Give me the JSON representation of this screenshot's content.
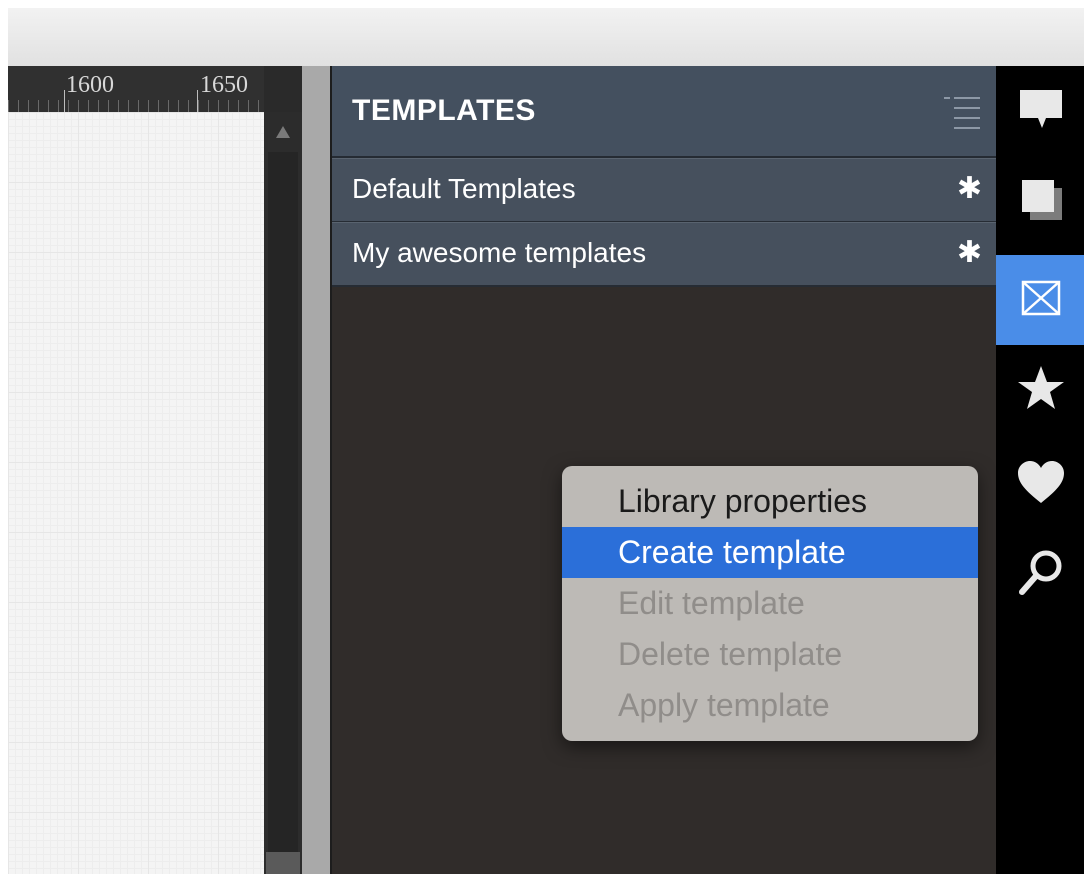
{
  "ruler": {
    "label_1600": "1600",
    "label_1650": "1650"
  },
  "templates_panel": {
    "title": "TEMPLATES",
    "menu_icon": "list-menu-icon",
    "libraries": [
      {
        "label": "Default Templates",
        "icon": "gear-icon"
      },
      {
        "label": "My awesome templates",
        "icon": "gear-icon"
      }
    ],
    "gear_glyph": "✱"
  },
  "context_menu": {
    "items": [
      {
        "label": "Library properties",
        "state": "enabled"
      },
      {
        "label": "Create template",
        "state": "selected"
      },
      {
        "label": "Edit template",
        "state": "disabled"
      },
      {
        "label": "Delete template",
        "state": "disabled"
      },
      {
        "label": "Apply template",
        "state": "disabled"
      }
    ]
  },
  "rail": {
    "items": [
      {
        "icon": "comment-icon",
        "active": false
      },
      {
        "icon": "layers-icon",
        "active": false
      },
      {
        "icon": "templates-icon",
        "active": true
      },
      {
        "icon": "star-icon",
        "active": false
      },
      {
        "icon": "heart-icon",
        "active": false
      },
      {
        "icon": "search-icon",
        "active": false
      }
    ]
  },
  "colors": {
    "panel_header": "#44505f",
    "panel_body": "#302c2a",
    "menu_selected": "#2b6fd9",
    "rail_active": "#4a8de8"
  }
}
